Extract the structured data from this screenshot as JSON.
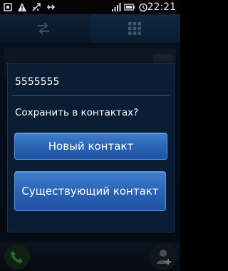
{
  "status_bar": {
    "time": "22:21",
    "icons": [
      "notification-icon",
      "warning-icon",
      "usb-icon",
      "signal-icon",
      "battery-icon",
      "alarm-icon"
    ]
  },
  "dialog": {
    "number": "5555555",
    "question": "Сохранить в контактах?",
    "new_contact_label": "Новый контакт",
    "existing_contact_label": "Существующий контакт"
  },
  "colors": {
    "dialog_bg": "#0a1d35",
    "button_blue": "#2a63b5",
    "status_bar": "#050505"
  }
}
